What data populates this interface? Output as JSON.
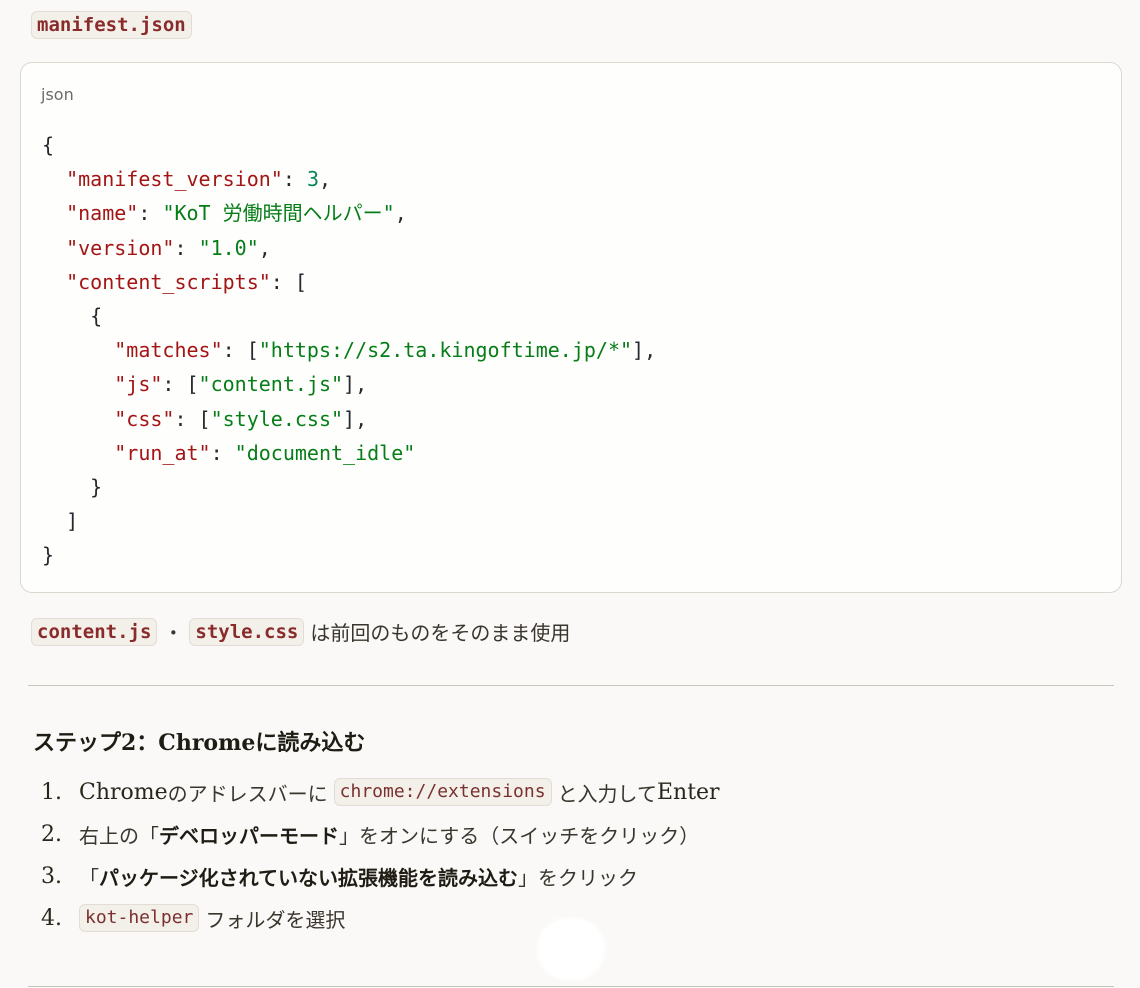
{
  "file_title": "manifest.json",
  "code_block": {
    "language": "json",
    "lines": [
      [
        {
          "t": "p",
          "v": "{"
        }
      ],
      [
        {
          "t": "p",
          "v": "  "
        },
        {
          "t": "k",
          "v": "\"manifest_version\""
        },
        {
          "t": "p",
          "v": ": "
        },
        {
          "t": "n",
          "v": "3"
        },
        {
          "t": "p",
          "v": ","
        }
      ],
      [
        {
          "t": "p",
          "v": "  "
        },
        {
          "t": "k",
          "v": "\"name\""
        },
        {
          "t": "p",
          "v": ": "
        },
        {
          "t": "s",
          "v": "\"KoT 労働時間ヘルパー\""
        },
        {
          "t": "p",
          "v": ","
        }
      ],
      [
        {
          "t": "p",
          "v": "  "
        },
        {
          "t": "k",
          "v": "\"version\""
        },
        {
          "t": "p",
          "v": ": "
        },
        {
          "t": "s",
          "v": "\"1.0\""
        },
        {
          "t": "p",
          "v": ","
        }
      ],
      [
        {
          "t": "p",
          "v": "  "
        },
        {
          "t": "k",
          "v": "\"content_scripts\""
        },
        {
          "t": "p",
          "v": ": ["
        }
      ],
      [
        {
          "t": "p",
          "v": "    {"
        }
      ],
      [
        {
          "t": "p",
          "v": "      "
        },
        {
          "t": "k",
          "v": "\"matches\""
        },
        {
          "t": "p",
          "v": ": ["
        },
        {
          "t": "s",
          "v": "\"https://s2.ta.kingoftime.jp/*\""
        },
        {
          "t": "p",
          "v": "],"
        }
      ],
      [
        {
          "t": "p",
          "v": "      "
        },
        {
          "t": "k",
          "v": "\"js\""
        },
        {
          "t": "p",
          "v": ": ["
        },
        {
          "t": "s",
          "v": "\"content.js\""
        },
        {
          "t": "p",
          "v": "],"
        }
      ],
      [
        {
          "t": "p",
          "v": "      "
        },
        {
          "t": "k",
          "v": "\"css\""
        },
        {
          "t": "p",
          "v": ": ["
        },
        {
          "t": "s",
          "v": "\"style.css\""
        },
        {
          "t": "p",
          "v": "],"
        }
      ],
      [
        {
          "t": "p",
          "v": "      "
        },
        {
          "t": "k",
          "v": "\"run_at\""
        },
        {
          "t": "p",
          "v": ": "
        },
        {
          "t": "s",
          "v": "\"document_idle\""
        }
      ],
      [
        {
          "t": "p",
          "v": "    }"
        }
      ],
      [
        {
          "t": "p",
          "v": "  ]"
        }
      ],
      [
        {
          "t": "p",
          "v": "}"
        }
      ]
    ]
  },
  "note": {
    "file1": "content.js",
    "separator": "・",
    "file2": "style.css",
    "text": "は前回のものをそのまま使用"
  },
  "step_heading": "ステップ2：Chromeに読み込む",
  "steps": [
    {
      "num": "1.",
      "prefix": "Chrome",
      "text1": "のアドレスバーに",
      "code": "chrome://extensions",
      "text2": "と入力して",
      "suffix": "Enter"
    },
    {
      "num": "2.",
      "text1": "右上の「",
      "strong": "デベロッパーモード",
      "text2": "」をオンにする（スイッチをクリック）"
    },
    {
      "num": "3.",
      "text1": "「",
      "strong": "パッケージ化されていない拡張機能を読み込む",
      "text2": "」をクリック"
    },
    {
      "num": "4.",
      "code": "kot-helper",
      "text1": "フォルダを選択"
    }
  ]
}
